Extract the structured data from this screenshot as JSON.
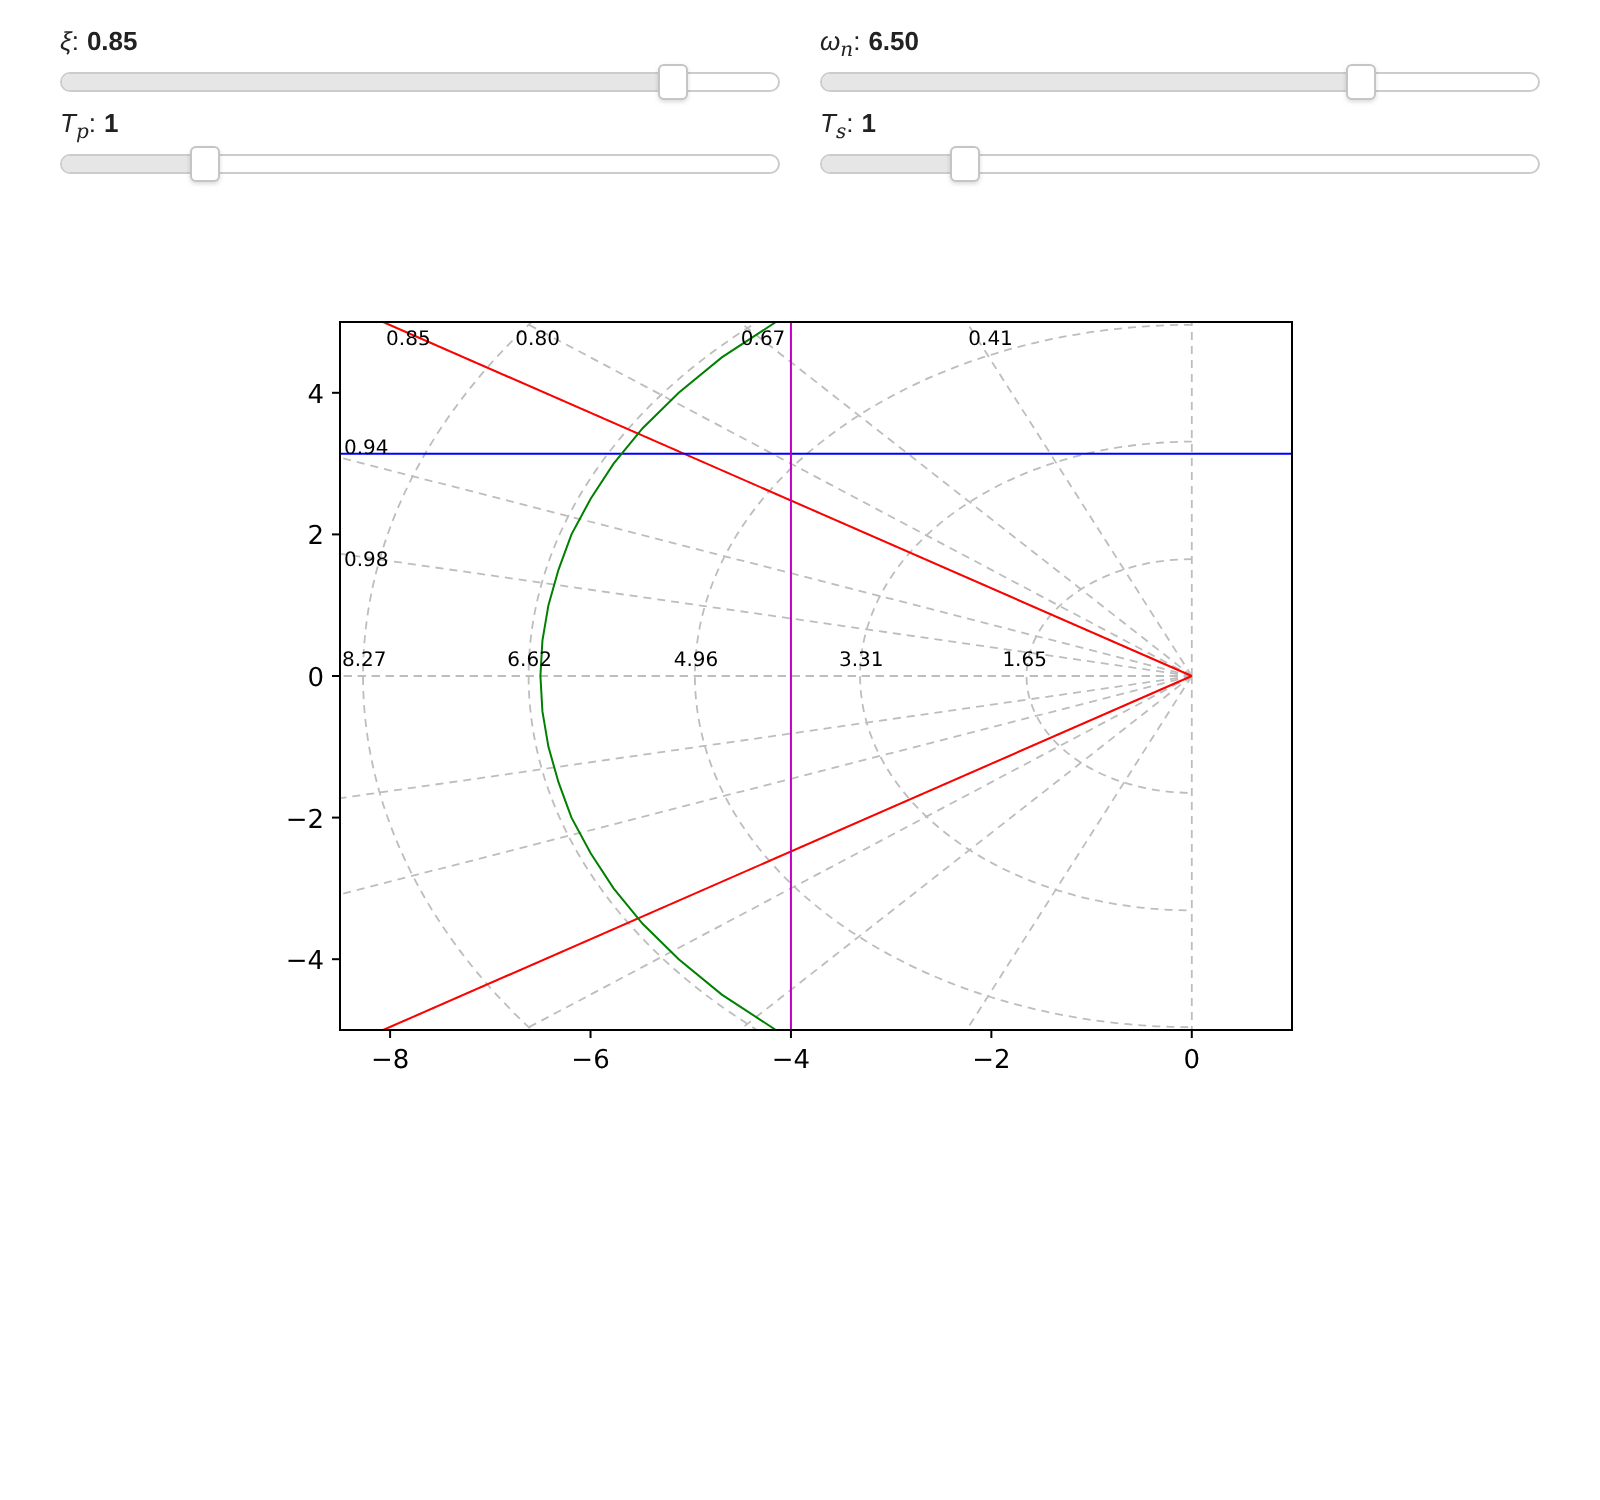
{
  "sliders": [
    {
      "label": "*ξ*:",
      "value": "0.85",
      "level": 0.85
    },
    {
      "label": "*ω*$_{n}$:",
      "value": "6.50",
      "level": 0.75
    },
    {
      "label": "*T*$_{p}$:",
      "value": "1",
      "level": 0.2
    },
    {
      "label": "*T*$_{s}$:",
      "value": "1",
      "level": 0.2
    }
  ],
  "plot": {
    "chart_data": {
      "type": "line",
      "xlim": [
        -8.5,
        1
      ],
      "ylim": [
        -5,
        5
      ],
      "xticks": [
        {
          "value": -8,
          "label": "−8"
        },
        {
          "value": -6,
          "label": "−6"
        },
        {
          "value": -4,
          "label": "−4"
        },
        {
          "value": -2,
          "label": "−2"
        },
        {
          "value": 0,
          "label": "0"
        }
      ],
      "yticks": [
        {
          "value": -4,
          "label": "−4"
        },
        {
          "value": -2,
          "label": "−2"
        },
        {
          "value": 0,
          "label": "0"
        },
        {
          "value": 2,
          "label": "2"
        },
        {
          "value": 4,
          "label": "4"
        }
      ],
      "series": [
        {
          "color": "#ff0000",
          "x": [
            0,
            -8.07
          ],
          "values": [
            0,
            5
          ]
        },
        {
          "color": "#ff0000",
          "x": [
            0,
            -8.07
          ],
          "values": [
            0,
            -5
          ]
        },
        {
          "color": "#0000ff",
          "x": [
            -8.5,
            1
          ],
          "values": [
            3.14,
            3.14
          ]
        },
        {
          "color": "#bf00bf",
          "x": [
            -4,
            -4
          ],
          "values": [
            -5,
            5
          ]
        },
        {
          "color": "#008000",
          "x": [
            -4.15,
            -4.69,
            -5.12,
            -5.48,
            -5.77,
            -6.0,
            -6.19,
            -6.32,
            -6.42,
            -6.48,
            -6.5,
            -6.48,
            -6.42,
            -6.32,
            -6.19,
            -6.0,
            -5.77,
            -5.48,
            -5.12,
            -4.69,
            -4.15
          ],
          "values": [
            5,
            4.5,
            4,
            3.5,
            3,
            2.5,
            2,
            1.5,
            1,
            0.5,
            0,
            -0.5,
            -1,
            -1.5,
            -2,
            -2.5,
            -3,
            -3.5,
            -4,
            -4.5,
            -5
          ]
        }
      ],
      "annotations": [
        "0.85",
        "0.80",
        "0.67",
        "0.41",
        "0.94",
        "0.98",
        "8.27",
        "6.62",
        "4.96",
        "3.31",
        "1.65"
      ]
    }
  }
}
